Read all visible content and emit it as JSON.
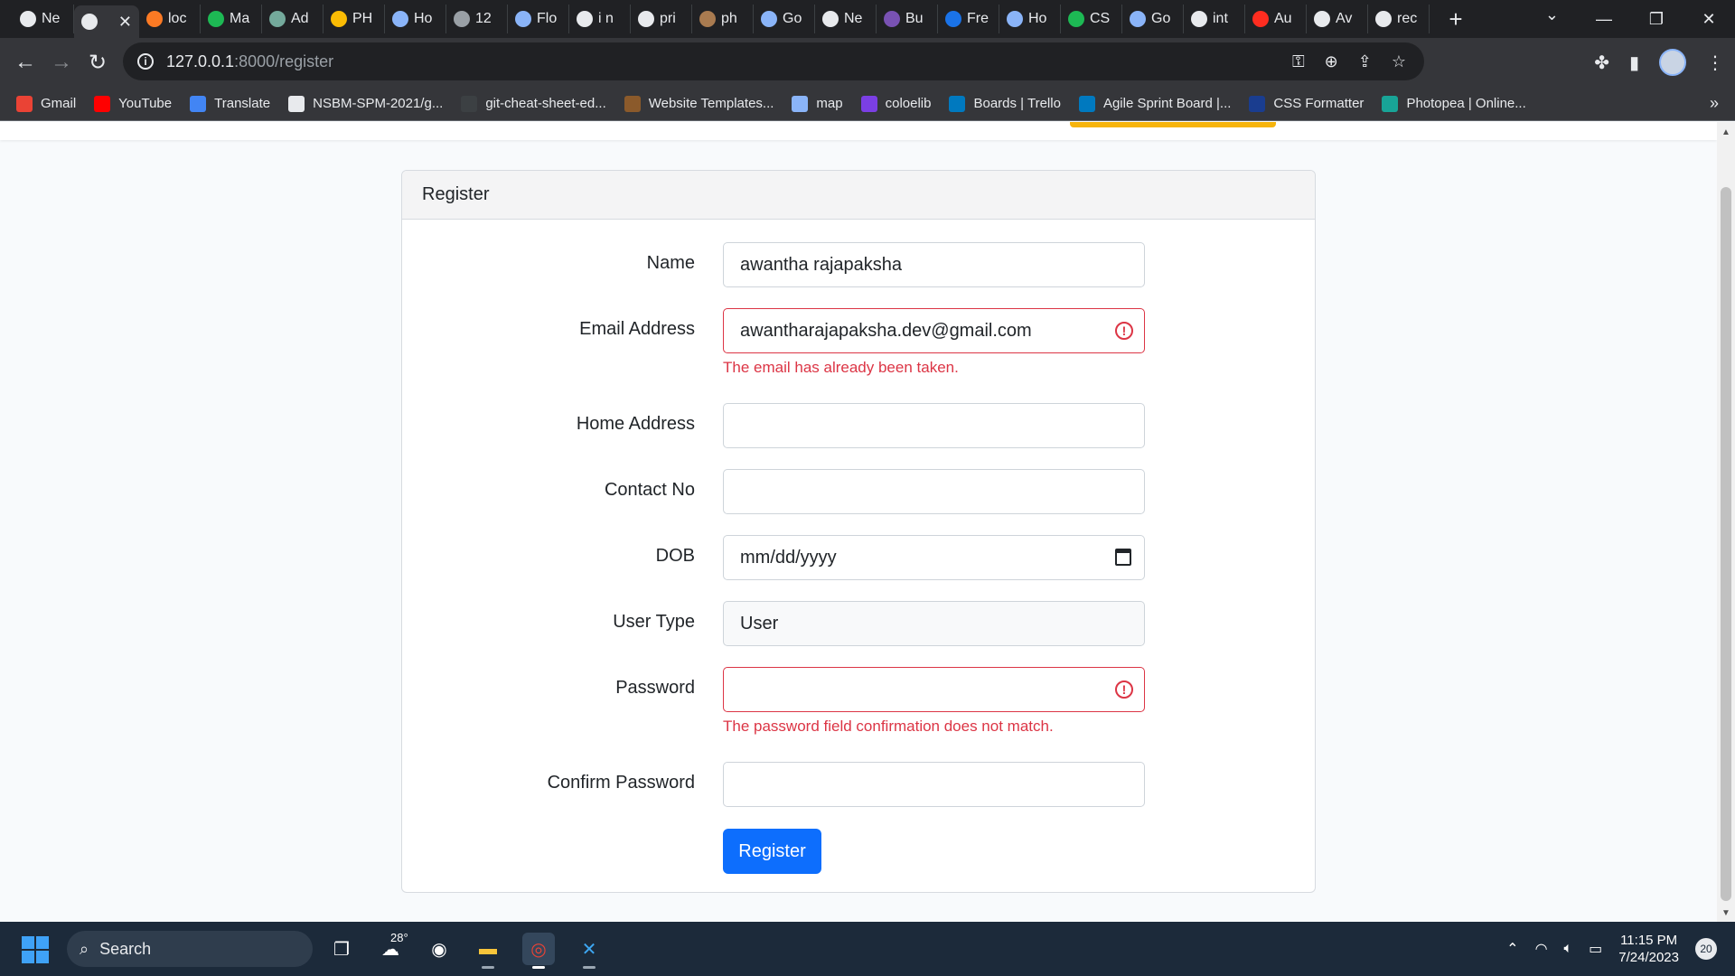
{
  "browser": {
    "tabs": [
      {
        "label": "Ne",
        "icon": "github-icon",
        "color": "#e8eaed"
      },
      {
        "label": "",
        "icon": "globe-icon",
        "color": "#e8eaed",
        "active": true
      },
      {
        "label": "loc",
        "icon": "xampp-icon",
        "color": "#fb7a24"
      },
      {
        "label": "Ma",
        "icon": "m-icon",
        "color": "#1db954"
      },
      {
        "label": "Ad",
        "icon": "openai-icon",
        "color": "#74aa9c"
      },
      {
        "label": "PH",
        "icon": "drive-icon",
        "color": "#fbbc04"
      },
      {
        "label": "Ho",
        "icon": "w3-icon",
        "color": "#8ab4f8"
      },
      {
        "label": "12",
        "icon": "globe-icon",
        "color": "#9aa0a6"
      },
      {
        "label": "Flo",
        "icon": "search-icon",
        "color": "#8ab4f8"
      },
      {
        "label": "i n",
        "icon": "google-icon",
        "color": "#e8eaed"
      },
      {
        "label": "pri",
        "icon": "google-icon",
        "color": "#e8eaed"
      },
      {
        "label": "ph",
        "icon": "php-icon",
        "color": "#a97b50"
      },
      {
        "label": "Go",
        "icon": "translate-icon",
        "color": "#8ab4f8"
      },
      {
        "label": "Ne",
        "icon": "github-icon",
        "color": "#e8eaed"
      },
      {
        "label": "Bu",
        "icon": "bootstrap-icon",
        "color": "#7952b3"
      },
      {
        "label": "Fre",
        "icon": "gear-icon",
        "color": "#1a73e8"
      },
      {
        "label": "Ho",
        "icon": "w3-icon",
        "color": "#8ab4f8"
      },
      {
        "label": "CS",
        "icon": "w-icon",
        "color": "#1db954"
      },
      {
        "label": "Go",
        "icon": "translate-icon",
        "color": "#8ab4f8"
      },
      {
        "label": "int",
        "icon": "google-icon",
        "color": "#e8eaed"
      },
      {
        "label": "Au",
        "icon": "laravel-icon",
        "color": "#ff2d20"
      },
      {
        "label": "Av",
        "icon": "github-icon",
        "color": "#e8eaed"
      },
      {
        "label": "rec",
        "icon": "google-icon",
        "color": "#e8eaed"
      }
    ],
    "new_tab": "+",
    "tab_close": "✕",
    "url_host": "127.0.0.1",
    "url_path": ":8000/register",
    "bookmarks": [
      {
        "label": "Gmail",
        "icon": "gmail-icon",
        "color": "#ea4335"
      },
      {
        "label": "YouTube",
        "icon": "youtube-icon",
        "color": "#ff0000"
      },
      {
        "label": "Translate",
        "icon": "translate-icon",
        "color": "#4285f4"
      },
      {
        "label": "NSBM-SPM-2021/g...",
        "icon": "github-icon",
        "color": "#e8eaed"
      },
      {
        "label": "git-cheat-sheet-ed...",
        "icon": "github-icon",
        "color": "#3c4043"
      },
      {
        "label": "Website Templates...",
        "icon": "template-icon",
        "color": "#8b5a2b"
      },
      {
        "label": "map",
        "icon": "map-icon",
        "color": "#8ab4f8"
      },
      {
        "label": "coloelib",
        "icon": "colorlib-icon",
        "color": "#7b3fe4"
      },
      {
        "label": "Boards | Trello",
        "icon": "trello-icon",
        "color": "#0079bf"
      },
      {
        "label": "Agile Sprint Board |...",
        "icon": "trello-icon",
        "color": "#0079bf"
      },
      {
        "label": "CSS Formatter",
        "icon": "dans-tools-icon",
        "color": "#1a3d8f"
      },
      {
        "label": "Photopea | Online...",
        "icon": "photopea-icon",
        "color": "#18a497"
      }
    ],
    "bookmarks_more": "»"
  },
  "form": {
    "title": "Register",
    "fields": [
      {
        "label": "Name",
        "value": "awantha rajapaksha",
        "state": "normal"
      },
      {
        "label": "Email Address",
        "value": "awantharajapaksha.dev@gmail.com",
        "state": "invalid",
        "error": "The email has already been taken."
      },
      {
        "label": "Home Address",
        "value": "",
        "state": "normal"
      },
      {
        "label": "Contact No",
        "value": "",
        "state": "normal"
      },
      {
        "label": "DOB",
        "value": "mm/dd/yyyy",
        "state": "normal"
      },
      {
        "label": "User Type",
        "value": "User",
        "state": "readonly"
      },
      {
        "label": "Password",
        "value": "",
        "state": "invalid",
        "error": "The password field confirmation does not match."
      },
      {
        "label": "Confirm Password",
        "value": "",
        "state": "normal"
      }
    ],
    "submit_label": "Register"
  },
  "taskbar": {
    "search_label": "Search",
    "weather_temp": "28°",
    "time": "11:15 PM",
    "date": "7/24/2023",
    "notifications": "20"
  },
  "colors": {
    "primary": "#0d6efd",
    "danger": "#dc3545",
    "chrome_dark": "#202124",
    "taskbar": "#1c2a3a"
  }
}
